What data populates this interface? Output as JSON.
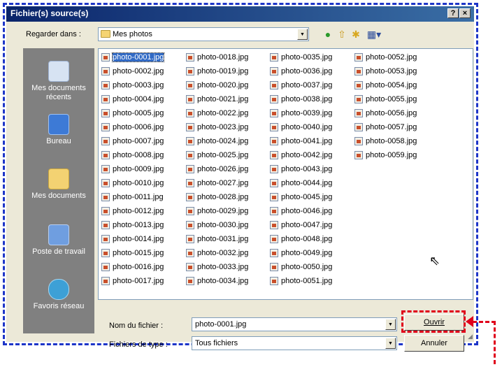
{
  "window": {
    "title": "Fichier(s) source(s)",
    "help_label": "?",
    "close_label": "×"
  },
  "toolbar": {
    "lookin_label": "Regarder dans :",
    "lookin_value": "Mes photos",
    "icons": [
      "back-icon",
      "up-folder-icon",
      "new-folder-icon",
      "views-menu-icon"
    ]
  },
  "places": [
    {
      "label": "Mes documents récents",
      "icon": "recent-documents-icon"
    },
    {
      "label": "Bureau",
      "icon": "desktop-icon"
    },
    {
      "label": "Mes documents",
      "icon": "my-documents-icon"
    },
    {
      "label": "Poste de travail",
      "icon": "my-computer-icon"
    },
    {
      "label": "Favoris réseau",
      "icon": "network-places-icon"
    }
  ],
  "files": {
    "selected": "photo-0001.jpg",
    "columns": [
      [
        "photo-0001.jpg",
        "photo-0002.jpg",
        "photo-0003.jpg",
        "photo-0004.jpg",
        "photo-0005.jpg",
        "photo-0006.jpg",
        "photo-0007.jpg",
        "photo-0008.jpg",
        "photo-0009.jpg",
        "photo-0010.jpg",
        "photo-0011.jpg",
        "photo-0012.jpg",
        "photo-0013.jpg",
        "photo-0014.jpg",
        "photo-0015.jpg",
        "photo-0016.jpg",
        "photo-0017.jpg"
      ],
      [
        "photo-0018.jpg",
        "photo-0019.jpg",
        "photo-0020.jpg",
        "photo-0021.jpg",
        "photo-0022.jpg",
        "photo-0023.jpg",
        "photo-0024.jpg",
        "photo-0025.jpg",
        "photo-0026.jpg",
        "photo-0027.jpg",
        "photo-0028.jpg",
        "photo-0029.jpg",
        "photo-0030.jpg",
        "photo-0031.jpg",
        "photo-0032.jpg",
        "photo-0033.jpg",
        "photo-0034.jpg"
      ],
      [
        "photo-0035.jpg",
        "photo-0036.jpg",
        "photo-0037.jpg",
        "photo-0038.jpg",
        "photo-0039.jpg",
        "photo-0040.jpg",
        "photo-0041.jpg",
        "photo-0042.jpg",
        "photo-0043.jpg",
        "photo-0044.jpg",
        "photo-0045.jpg",
        "photo-0046.jpg",
        "photo-0047.jpg",
        "photo-0048.jpg",
        "photo-0049.jpg",
        "photo-0050.jpg",
        "photo-0051.jpg"
      ],
      [
        "photo-0052.jpg",
        "photo-0053.jpg",
        "photo-0054.jpg",
        "photo-0055.jpg",
        "photo-0056.jpg",
        "photo-0057.jpg",
        "photo-0058.jpg",
        "photo-0059.jpg"
      ]
    ]
  },
  "filename": {
    "label": "Nom du fichier :",
    "value": "photo-0001.jpg"
  },
  "filetype": {
    "label": "Fichiers de type :",
    "value": "Tous fichiers"
  },
  "buttons": {
    "open_label": "Ouvrir",
    "cancel_label": "Annuler"
  },
  "colors": {
    "frame_dashes": "#1d35c8",
    "callout": "#e0001b",
    "titlebar": "#0a246a",
    "selection": "#316ac5"
  }
}
